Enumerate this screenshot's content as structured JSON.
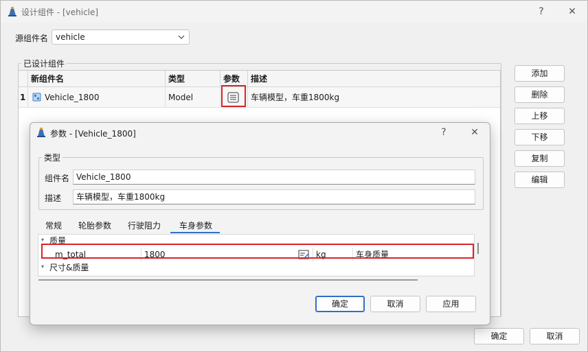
{
  "outer": {
    "title": "设计组件 - [vehicle]",
    "help": "?",
    "close": "✕",
    "source_label": "源组件名",
    "source_value": "vehicle",
    "group_title": "已设计组件",
    "columns": [
      "新组件名",
      "类型",
      "参数",
      "描述"
    ],
    "rows": [
      {
        "index": "1",
        "name": "Vehicle_1800",
        "type": "Model",
        "desc": "车辆模型，车重1800kg"
      }
    ],
    "side_buttons": [
      "添加",
      "删除",
      "上移",
      "下移",
      "复制",
      "编辑"
    ],
    "ok": "确定",
    "cancel": "取消"
  },
  "dialog": {
    "title": "参数 - [Vehicle_1800]",
    "help": "?",
    "close": "✕",
    "type_group": "类型",
    "name_label": "组件名",
    "name_value": "Vehicle_1800",
    "desc_label": "描述",
    "desc_value": "车辆模型，车重1800kg",
    "tabs": [
      "常规",
      "轮胎参数",
      "行驶阻力",
      "车身参数"
    ],
    "active_tab": 3,
    "grid": {
      "cat1": "质量",
      "row1": {
        "name": "m_total",
        "value": "1800",
        "unit": "kg",
        "desc": "车身质量"
      },
      "cat2": "尺寸&质量"
    },
    "ok": "确定",
    "cancel": "取消",
    "apply": "应用"
  },
  "colors": {
    "accent": "#2f6fc6",
    "highlight": "#d8232a"
  }
}
